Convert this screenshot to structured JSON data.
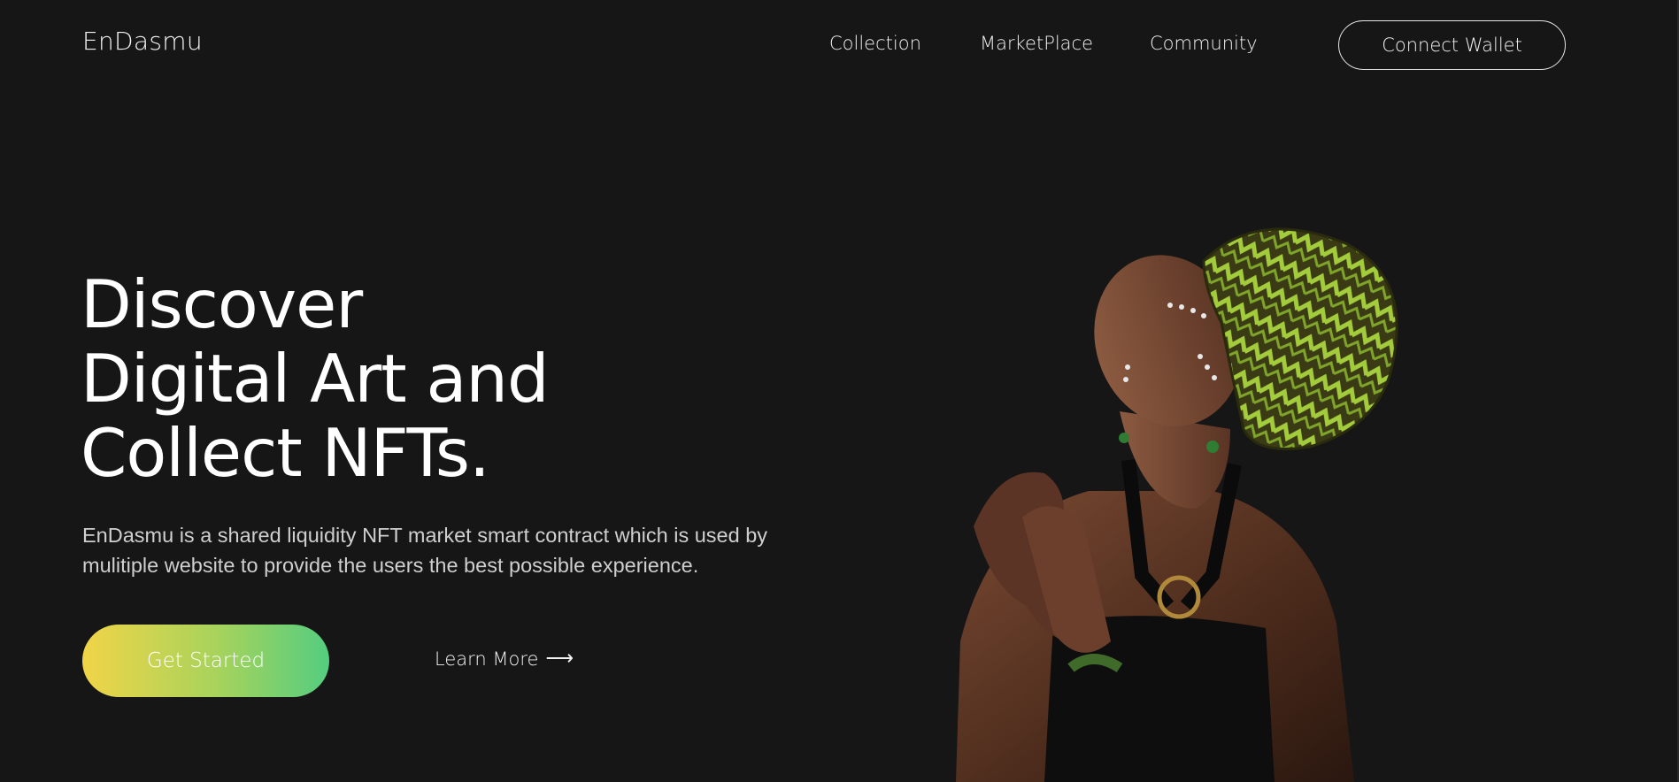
{
  "header": {
    "brand": "EnDasmu",
    "nav": [
      {
        "label": "Collection"
      },
      {
        "label": "MarketPlace"
      },
      {
        "label": "Community"
      }
    ],
    "connect_label": "Connect Wallet"
  },
  "hero": {
    "title_lines": [
      "Discover",
      "Digital Art and",
      "Collect NFTs."
    ],
    "description_lines": [
      "EnDasmu is a shared liquidity NFT market smart contract which is used by",
      "mulitiple website to provide the users the best possible experience."
    ],
    "cta_label": "Get Started",
    "learn_more_label": "Learn More",
    "learn_more_icon": "arrow-right-icon"
  },
  "colors": {
    "background": "#161616",
    "cta_gradient_start": "#f1d447",
    "cta_gradient_end": "#54cd80",
    "headwrap_green": "#9bc63a"
  }
}
